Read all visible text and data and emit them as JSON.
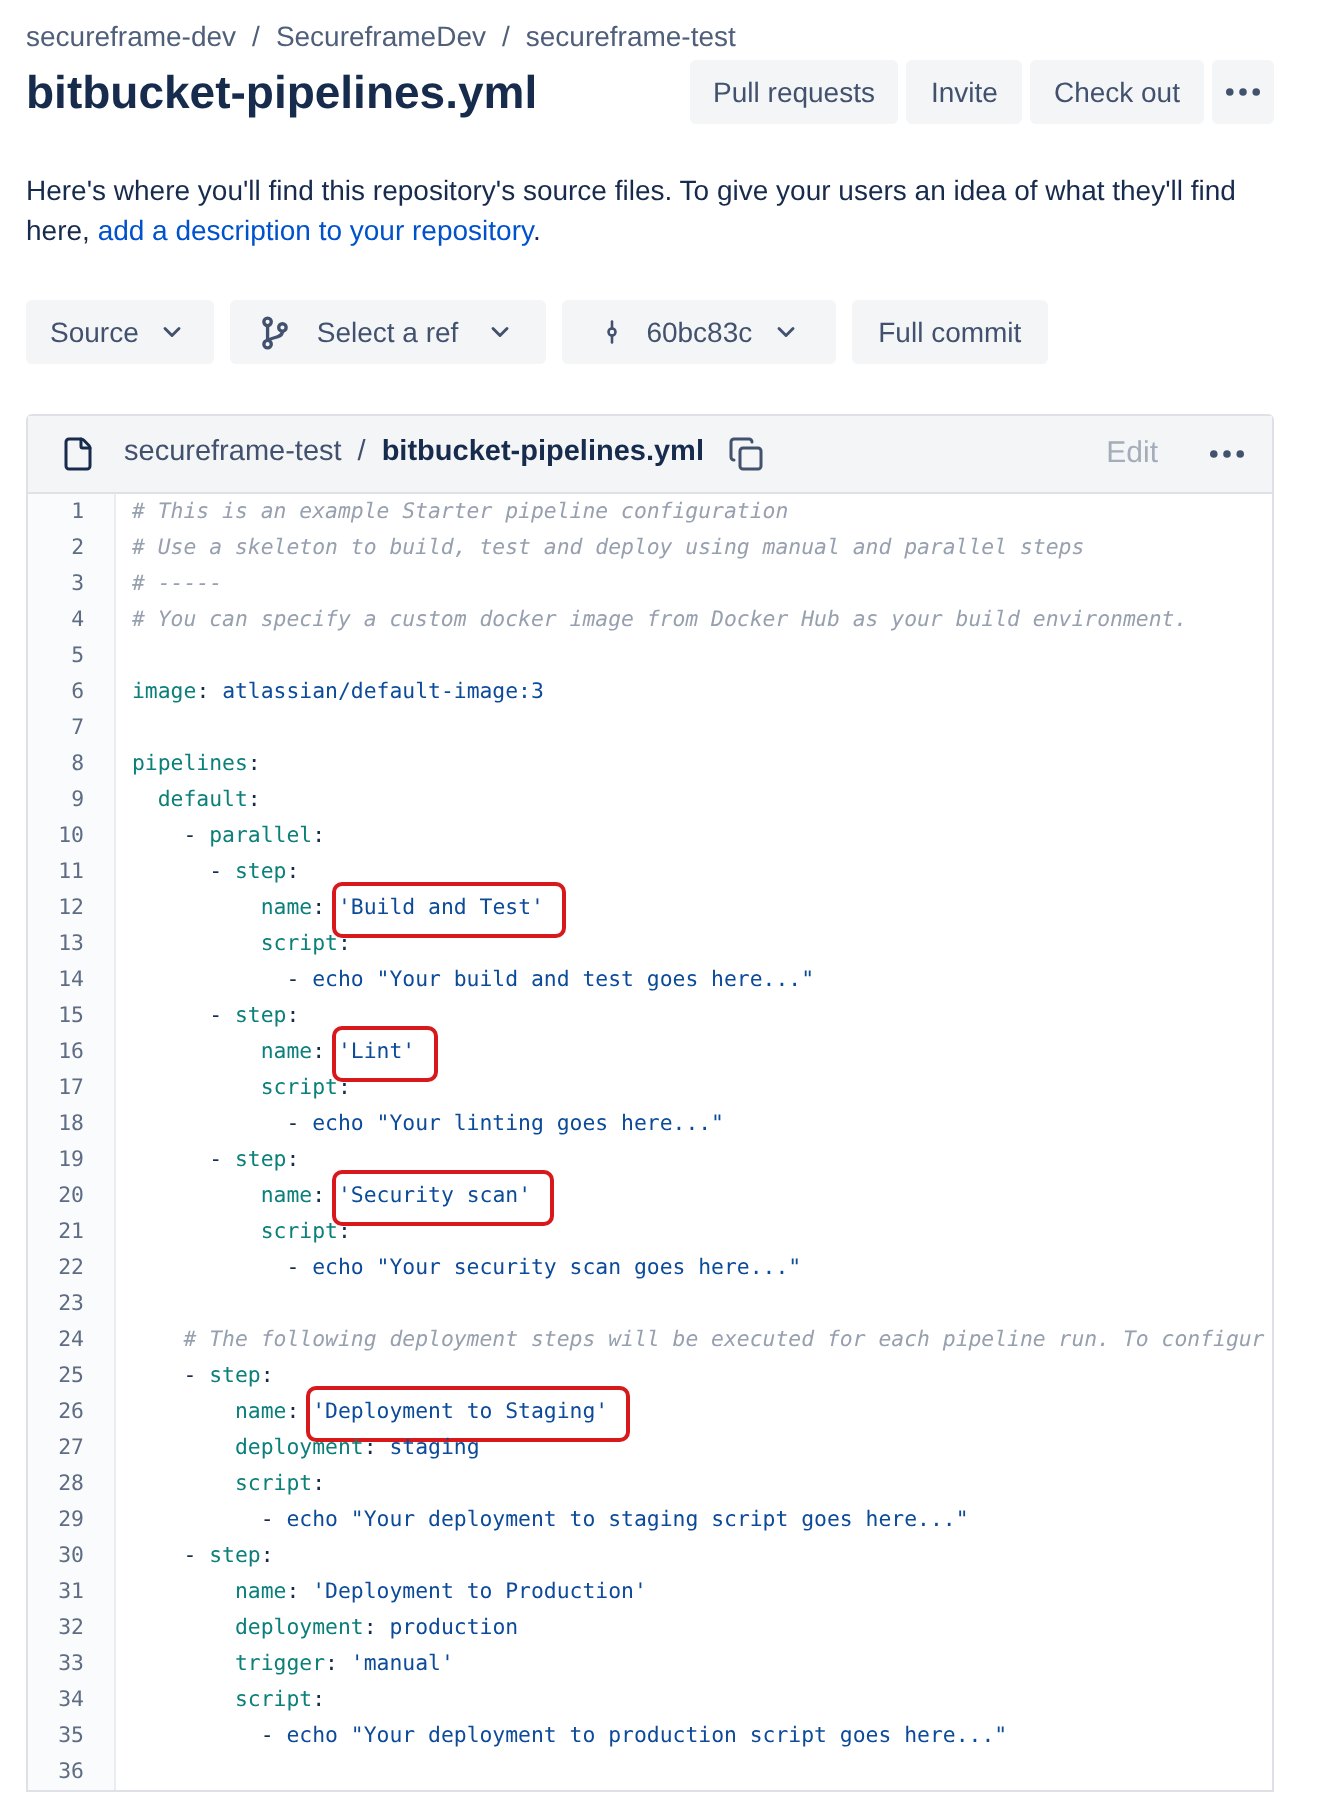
{
  "breadcrumbs": [
    {
      "kind": "link",
      "text": "secureframe-dev"
    },
    {
      "kind": "separator",
      "text": "/"
    },
    {
      "kind": "link",
      "text": "SecureframeDev"
    },
    {
      "kind": "separator",
      "text": "/"
    },
    {
      "kind": "link",
      "text": "secureframe-test"
    }
  ],
  "title": "bitbucket-pipelines.yml",
  "actions": [
    {
      "kind": "text",
      "label": "Pull requests"
    },
    {
      "kind": "text",
      "label": "Invite"
    },
    {
      "kind": "text",
      "label": "Check out"
    },
    {
      "kind": "more"
    }
  ],
  "description": {
    "before": "Here's where you'll find this repository's source files. To give your users an idea of what they'll find here,",
    "link": "add a description to your repository",
    "after": "."
  },
  "toolbar": [
    {
      "kind": "dropdown",
      "label": "Source"
    },
    {
      "kind": "ref",
      "label": "Select a ref"
    },
    {
      "kind": "commit",
      "label": "60bc83c"
    },
    {
      "kind": "plain",
      "label": "Full commit"
    }
  ],
  "file": {
    "path": [
      {
        "kind": "link",
        "text": "secureframe-test"
      },
      {
        "kind": "separator",
        "text": "/"
      },
      {
        "kind": "current",
        "text": "bitbucket-pipelines.yml"
      }
    ],
    "edit": {
      "label": "Edit",
      "disabled": true
    },
    "lines": [
      {
        "number": "1",
        "tokens": [
          {
            "kind": "comment",
            "text": "# This is an example Starter pipeline configuration"
          }
        ]
      },
      {
        "number": "2",
        "tokens": [
          {
            "kind": "comment",
            "text": "# Use a skeleton to build, test and deploy using manual and parallel steps"
          }
        ]
      },
      {
        "number": "3",
        "tokens": [
          {
            "kind": "comment",
            "text": "# -----"
          }
        ]
      },
      {
        "number": "4",
        "tokens": [
          {
            "kind": "comment",
            "text": "# You can specify a custom docker image from Docker Hub as your build environment."
          }
        ]
      },
      {
        "number": "5"
      },
      {
        "number": "6",
        "tokens": [
          {
            "kind": "key",
            "text": "image"
          },
          {
            "kind": "punct",
            "text": ": "
          },
          {
            "kind": "value",
            "text": "atlassian/default-image:3"
          }
        ]
      },
      {
        "number": "7"
      },
      {
        "number": "8",
        "tokens": [
          {
            "kind": "key",
            "text": "pipelines"
          },
          {
            "kind": "punct",
            "text": ":"
          }
        ]
      },
      {
        "number": "9",
        "tokens": [
          {
            "kind": "key",
            "text": "  default"
          },
          {
            "kind": "punct",
            "text": ":"
          }
        ]
      },
      {
        "number": "10",
        "tokens": [
          {
            "kind": "plain",
            "text": "    - "
          },
          {
            "kind": "key",
            "text": "parallel"
          },
          {
            "kind": "punct",
            "text": ":"
          }
        ]
      },
      {
        "number": "11",
        "tokens": [
          {
            "kind": "plain",
            "text": "      - "
          },
          {
            "kind": "key",
            "text": "step"
          },
          {
            "kind": "punct",
            "text": ":"
          }
        ]
      },
      {
        "number": "12",
        "tokens": [
          {
            "kind": "key",
            "text": "          name"
          },
          {
            "kind": "punct",
            "text": ": "
          },
          {
            "kind": "value",
            "text": "'Build and Test'",
            "highlighted": true
          }
        ]
      },
      {
        "number": "13",
        "tokens": [
          {
            "kind": "key",
            "text": "          script"
          },
          {
            "kind": "punct",
            "text": ":"
          }
        ]
      },
      {
        "number": "14",
        "tokens": [
          {
            "kind": "plain",
            "text": "            - "
          },
          {
            "kind": "value",
            "text": "echo \"Your build and test goes here...\""
          }
        ]
      },
      {
        "number": "15",
        "tokens": [
          {
            "kind": "plain",
            "text": "      - "
          },
          {
            "kind": "key",
            "text": "step"
          },
          {
            "kind": "punct",
            "text": ":"
          }
        ]
      },
      {
        "number": "16",
        "tokens": [
          {
            "kind": "key",
            "text": "          name"
          },
          {
            "kind": "punct",
            "text": ": "
          },
          {
            "kind": "value",
            "text": "'Lint'",
            "highlighted": true
          }
        ]
      },
      {
        "number": "17",
        "tokens": [
          {
            "kind": "key",
            "text": "          script"
          },
          {
            "kind": "punct",
            "text": ":"
          }
        ]
      },
      {
        "number": "18",
        "tokens": [
          {
            "kind": "plain",
            "text": "            - "
          },
          {
            "kind": "value",
            "text": "echo \"Your linting goes here...\""
          }
        ]
      },
      {
        "number": "19",
        "tokens": [
          {
            "kind": "plain",
            "text": "      - "
          },
          {
            "kind": "key",
            "text": "step"
          },
          {
            "kind": "punct",
            "text": ":"
          }
        ]
      },
      {
        "number": "20",
        "tokens": [
          {
            "kind": "key",
            "text": "          name"
          },
          {
            "kind": "punct",
            "text": ": "
          },
          {
            "kind": "value",
            "text": "'Security scan'",
            "highlighted": true
          }
        ]
      },
      {
        "number": "21",
        "tokens": [
          {
            "kind": "key",
            "text": "          script"
          },
          {
            "kind": "punct",
            "text": ":"
          }
        ]
      },
      {
        "number": "22",
        "tokens": [
          {
            "kind": "plain",
            "text": "            - "
          },
          {
            "kind": "value",
            "text": "echo \"Your security scan goes here...\""
          }
        ]
      },
      {
        "number": "23"
      },
      {
        "number": "24",
        "tokens": [
          {
            "kind": "comment",
            "text": "    # The following deployment steps will be executed for each pipeline run. To configur"
          }
        ]
      },
      {
        "number": "25",
        "tokens": [
          {
            "kind": "plain",
            "text": "    - "
          },
          {
            "kind": "key",
            "text": "step"
          },
          {
            "kind": "punct",
            "text": ":"
          }
        ]
      },
      {
        "number": "26",
        "tokens": [
          {
            "kind": "key",
            "text": "        name"
          },
          {
            "kind": "punct",
            "text": ": "
          },
          {
            "kind": "value",
            "text": "'Deployment to Staging'",
            "highlighted": true
          }
        ]
      },
      {
        "number": "27",
        "tokens": [
          {
            "kind": "key",
            "text": "        deployment"
          },
          {
            "kind": "punct",
            "text": ": "
          },
          {
            "kind": "value",
            "text": "staging"
          }
        ]
      },
      {
        "number": "28",
        "tokens": [
          {
            "kind": "key",
            "text": "        script"
          },
          {
            "kind": "punct",
            "text": ":"
          }
        ]
      },
      {
        "number": "29",
        "tokens": [
          {
            "kind": "plain",
            "text": "          - "
          },
          {
            "kind": "value",
            "text": "echo \"Your deployment to staging script goes here...\""
          }
        ]
      },
      {
        "number": "30",
        "tokens": [
          {
            "kind": "plain",
            "text": "    - "
          },
          {
            "kind": "key",
            "text": "step"
          },
          {
            "kind": "punct",
            "text": ":"
          }
        ]
      },
      {
        "number": "31",
        "tokens": [
          {
            "kind": "key",
            "text": "        name"
          },
          {
            "kind": "punct",
            "text": ": "
          },
          {
            "kind": "value",
            "text": "'Deployment to Production'"
          }
        ]
      },
      {
        "number": "32",
        "tokens": [
          {
            "kind": "key",
            "text": "        deployment"
          },
          {
            "kind": "punct",
            "text": ": "
          },
          {
            "kind": "value",
            "text": "production"
          }
        ]
      },
      {
        "number": "33",
        "tokens": [
          {
            "kind": "key",
            "text": "        trigger"
          },
          {
            "kind": "punct",
            "text": ": "
          },
          {
            "kind": "value",
            "text": "'manual'"
          }
        ]
      },
      {
        "number": "34",
        "tokens": [
          {
            "kind": "key",
            "text": "        script"
          },
          {
            "kind": "punct",
            "text": ":"
          }
        ]
      },
      {
        "number": "35",
        "tokens": [
          {
            "kind": "plain",
            "text": "          - "
          },
          {
            "kind": "value",
            "text": "echo \"Your deployment to production script goes here...\""
          }
        ]
      },
      {
        "number": "36"
      }
    ]
  }
}
